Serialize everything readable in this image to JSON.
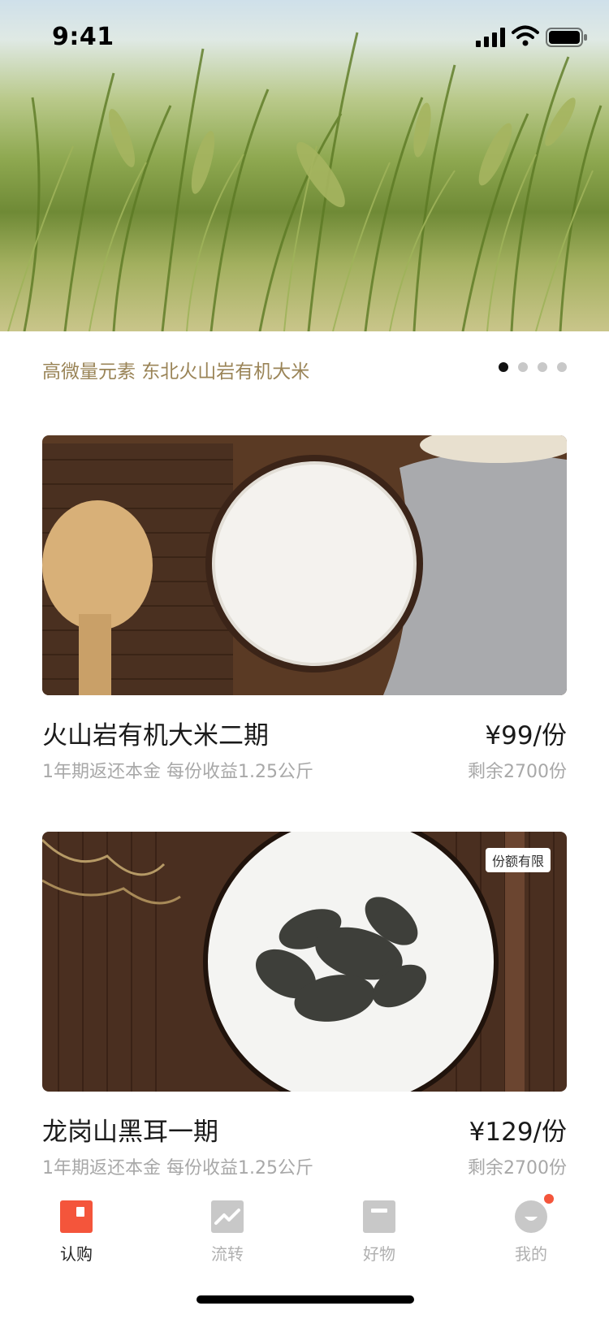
{
  "status_bar": {
    "time": "9:41"
  },
  "banner": {
    "caption": "高微量元素 东北火山岩有机大米",
    "page_count": 4,
    "active_page": 1
  },
  "products": [
    {
      "title": "火山岩有机大米二期",
      "price": "¥99/份",
      "subtitle": "1年期返还本金 每份收益1.25公斤",
      "remaining": "剩余2700份",
      "tag": ""
    },
    {
      "title": "龙岗山黑耳一期",
      "price": "¥129/份",
      "subtitle": "1年期返还本金 每份收益1.25公斤",
      "remaining": "剩余2700份",
      "tag": "份额有限"
    }
  ],
  "tabbar": {
    "items": [
      {
        "label": "认购",
        "icon": "subscribe-icon",
        "active": true
      },
      {
        "label": "流转",
        "icon": "trend-icon",
        "active": false
      },
      {
        "label": "好物",
        "icon": "goods-icon",
        "active": false
      },
      {
        "label": "我的",
        "icon": "profile-icon",
        "active": false,
        "badge": true
      }
    ]
  },
  "colors": {
    "accent": "#f4553b",
    "caption": "#9a8457",
    "inactive": "#c8c8c8"
  }
}
